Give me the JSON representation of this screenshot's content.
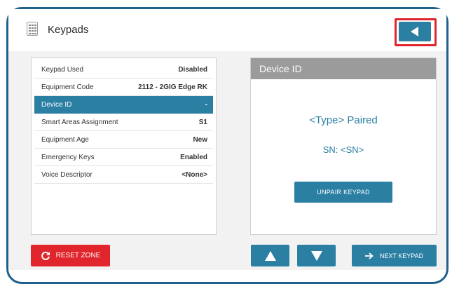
{
  "header": {
    "title": "Keypads",
    "icon": "keypad-icon",
    "back_icon": "back-arrow-icon"
  },
  "list": {
    "rows": [
      {
        "label": "Keypad Used",
        "value": "Disabled"
      },
      {
        "label": "Equipment Code",
        "value": "2112 - 2GIG Edge RK"
      },
      {
        "label": "Device ID",
        "value": "-"
      },
      {
        "label": "Smart Areas Assignment",
        "value": "S1"
      },
      {
        "label": "Equipment Age",
        "value": "New"
      },
      {
        "label": "Emergency Keys",
        "value": "Enabled"
      },
      {
        "label": "Voice Descriptor",
        "value": "<None>"
      }
    ]
  },
  "detail": {
    "title": "Device ID",
    "paired_text": "<Type> Paired",
    "sn_text": "SN: <SN>",
    "unpair_label": "UNPAIR KEYPAD"
  },
  "footer": {
    "reset_label": "RESET ZONE",
    "next_label": "NEXT KEYPAD"
  },
  "colors": {
    "accent": "#2a7fa3",
    "danger": "#e0262c",
    "frame": "#1f5f8b",
    "panel_header": "#9b9b9b"
  }
}
